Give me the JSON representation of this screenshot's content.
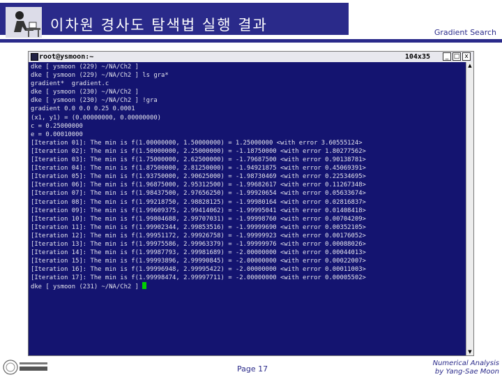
{
  "slide": {
    "title": "이차원 경사도 탐색법 실행 결과",
    "section": "Gradient Search",
    "page": "Page 17",
    "footer_line1": "Numerical Analysis",
    "footer_line2": "by Yang-Sae Moon"
  },
  "terminal": {
    "title": "root@ysmoon:~",
    "size": "104x35",
    "buttons": {
      "minimize": "_",
      "maximize": "□",
      "close": "x"
    },
    "lines": [
      "dke [ ysmoon (229) ~/NA/Ch2 ]",
      "dke [ ysmoon (229) ~/NA/Ch2 ] ls gra*",
      "gradient*  gradient.c",
      "dke [ ysmoon (230) ~/NA/Ch2 ]",
      "dke [ ysmoon (230) ~/NA/Ch2 ] !gra",
      "gradient 0.0 0.0 0.25 0.0001",
      "(x1, y1) = (0.00000000, 0.00000000)",
      "c = 0.25000000",
      "e = 0.00010000",
      "[Iteration 01]: The min is f(1.00000000, 1.50000000) = 1.25000000 <with error 3.60555124>",
      "[Iteration 02]: The min is f(1.50000000, 2.25000000) = -1.18750000 <with error 1.80277562>",
      "[Iteration 03]: The min is f(1.75000000, 2.62500000) = -1.79687500 <with error 0.90138781>",
      "[Iteration 04]: The min is f(1.87500000, 2.81250000) = -1.94921875 <with error 0.45069391>",
      "[Iteration 05]: The min is f(1.93750000, 2.90625000) = -1.98730469 <with error 0.22534695>",
      "[Iteration 06]: The min is f(1.96875000, 2.95312500) = -1.99682617 <with error 0.11267348>",
      "[Iteration 07]: The min is f(1.98437500, 2.97656250) = -1.99920654 <with error 0.05633674>",
      "[Iteration 08]: The min is f(1.99218750, 2.98828125) = -1.99980164 <with error 0.02816837>",
      "[Iteration 09]: The min is f(1.99609375, 2.99414062) = -1.99995041 <with error 0.01408418>",
      "[Iteration 10]: The min is f(1.99804688, 2.99707031) = -1.99998760 <with error 0.00704209>",
      "[Iteration 11]: The min is f(1.99902344, 2.99853516) = -1.99999690 <with error 0.00352105>",
      "[Iteration 12]: The min is f(1.99951172, 2.99926758) = -1.99999923 <with error 0.00176052>",
      "[Iteration 13]: The min is f(1.99975586, 2.99963379) = -1.99999976 <with error 0.00088026>",
      "[Iteration 14]: The min is f(1.99987793, 2.99981689) = -2.00000000 <with error 0.00044013>",
      "[Iteration 15]: The min is f(1.99993896, 2.99990845) = -2.00000000 <with error 0.00022007>",
      "[Iteration 16]: The min is f(1.99996948, 2.99995422) = -2.00000000 <with error 0.00011003>",
      "[Iteration 17]: The min is f(1.99998474, 2.99997711) = -2.00000000 <with error 0.00005502>"
    ],
    "last_prompt": "dke [ ysmoon (231) ~/NA/Ch2 ] "
  },
  "colors": {
    "header_bar": "#2a2a8a",
    "terminal_bg": "#141470",
    "terminal_text": "#e4e4ee",
    "cursor": "#00d000"
  },
  "icons": {
    "header_logo": "person-at-desk-icon",
    "footer_logo": "university-seal-icon",
    "terminal_icon": "terminal-icon"
  }
}
